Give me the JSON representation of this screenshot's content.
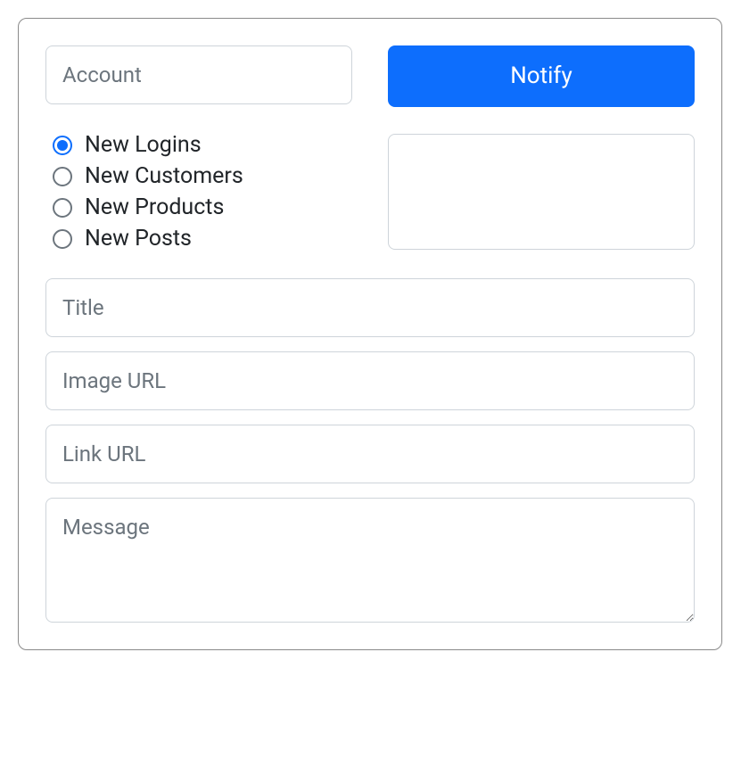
{
  "topRow": {
    "accountPlaceholder": "Account",
    "notifyLabel": "Notify"
  },
  "radioOptions": [
    {
      "label": "New Logins",
      "checked": true
    },
    {
      "label": "New Customers",
      "checked": false
    },
    {
      "label": "New Products",
      "checked": false
    },
    {
      "label": "New Posts",
      "checked": false
    }
  ],
  "fields": {
    "titlePlaceholder": "Title",
    "imageUrlPlaceholder": "Image URL",
    "linkUrlPlaceholder": "Link URL",
    "messagePlaceholder": "Message"
  }
}
